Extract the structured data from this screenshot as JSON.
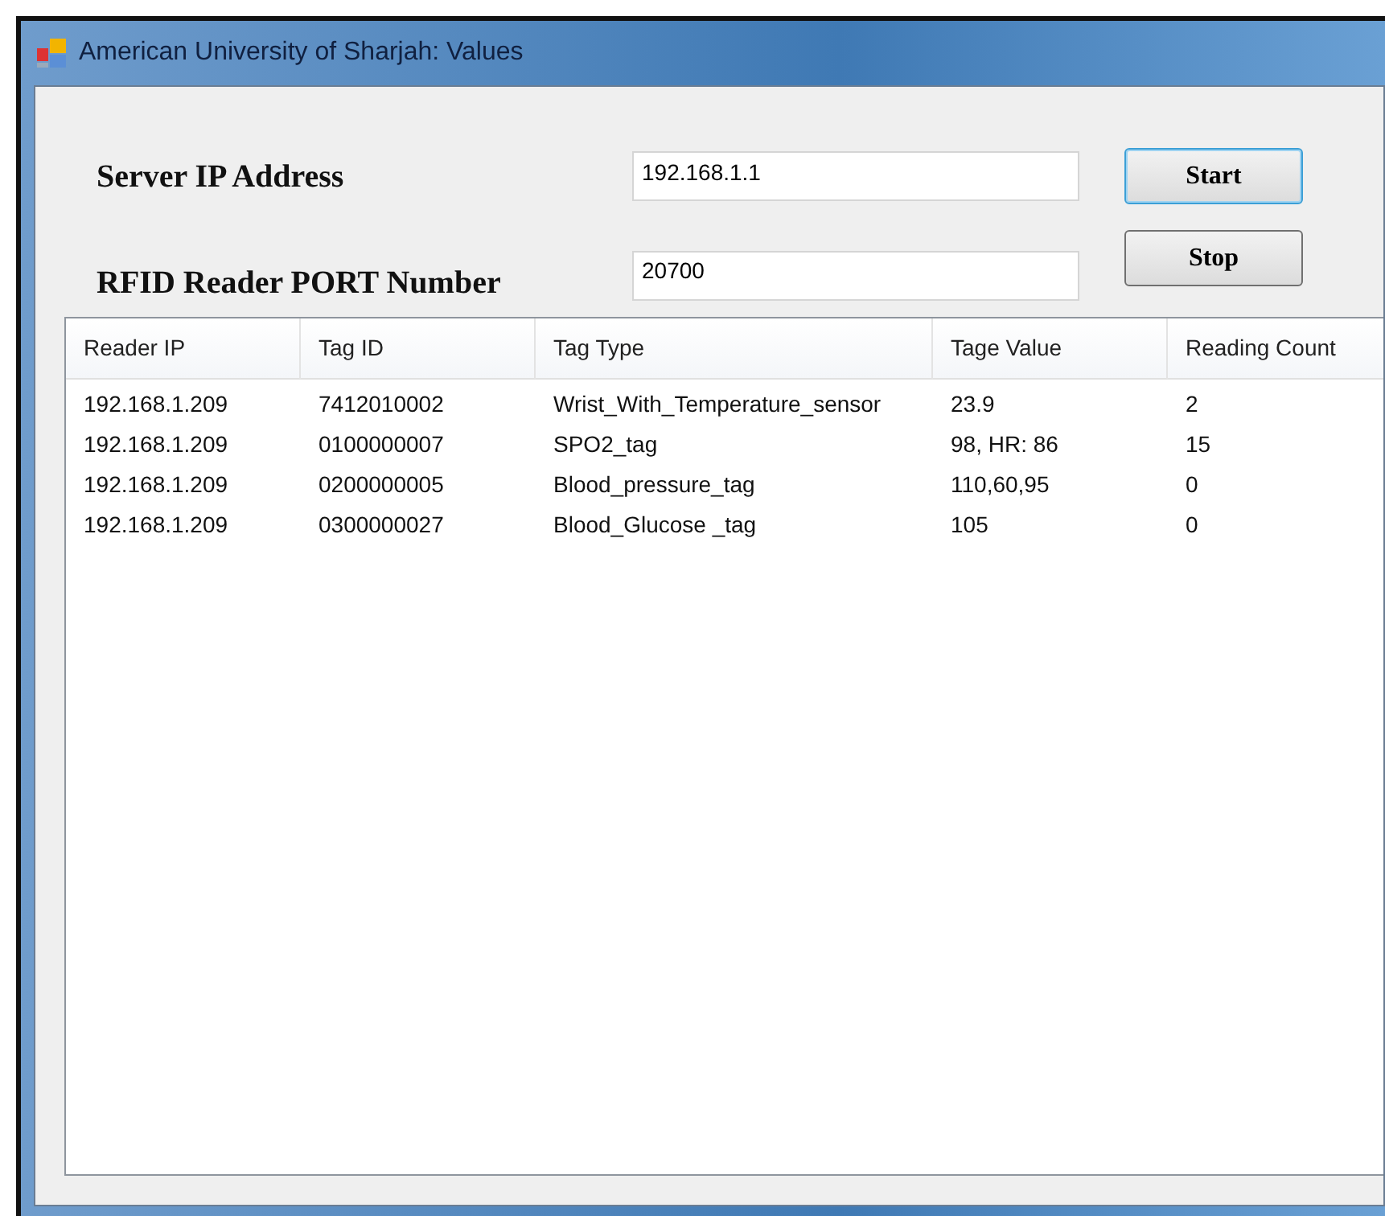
{
  "window": {
    "title": "American University of Sharjah: Values"
  },
  "server_ip": {
    "label": "Server IP Address",
    "value": "192.168.1.1"
  },
  "port": {
    "label": "RFID Reader PORT Number",
    "value": "20700"
  },
  "buttons": [
    {
      "label": "Start",
      "focused": true
    },
    {
      "label": "Stop",
      "focused": false
    }
  ],
  "table": {
    "columns": [
      "Reader IP",
      "Tag ID",
      "Tag Type",
      "Tage Value",
      "Reading Count"
    ],
    "rows": [
      [
        "192.168.1.209",
        "7412010002",
        "Wrist_With_Temperature_sensor",
        "23.9",
        "2"
      ],
      [
        "192.168.1.209",
        "0100000007",
        "SPO2_tag",
        "98, HR: 86",
        "15"
      ],
      [
        "192.168.1.209",
        "0200000005",
        "Blood_pressure_tag",
        "110,60,95",
        "0"
      ],
      [
        "192.168.1.209",
        "0300000027",
        "Blood_Glucose _tag",
        "105",
        "0"
      ]
    ]
  }
}
